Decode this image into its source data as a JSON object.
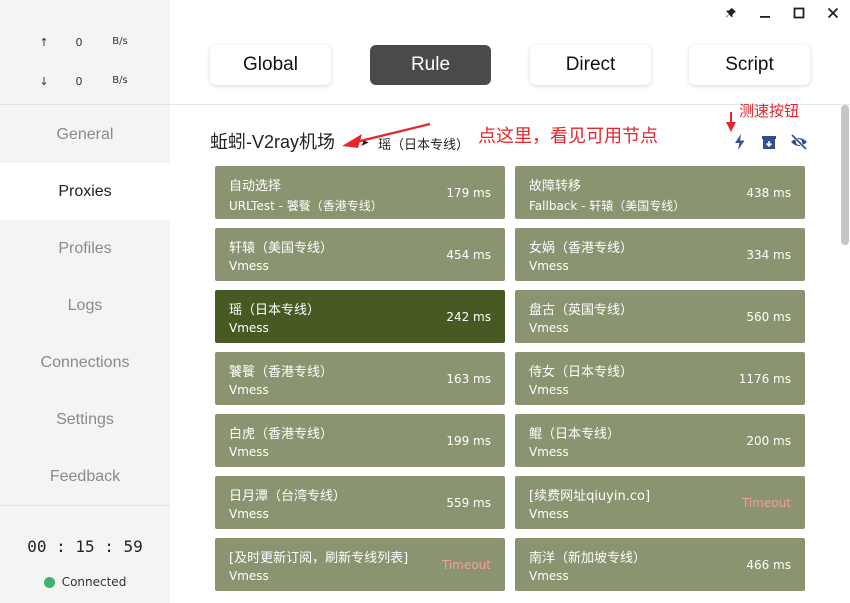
{
  "window": {
    "pin_icon": "pin-icon",
    "minimize_icon": "minimize-icon",
    "maximize_icon": "maximize-icon",
    "close_icon": "close-icon"
  },
  "traffic": {
    "up_arrow": "↑",
    "up_value": "0",
    "up_unit": "B/s",
    "down_arrow": "↓",
    "down_value": "0",
    "down_unit": "B/s"
  },
  "sidebar": {
    "items": [
      {
        "label": "General",
        "active": false
      },
      {
        "label": "Proxies",
        "active": true
      },
      {
        "label": "Profiles",
        "active": false
      },
      {
        "label": "Logs",
        "active": false
      },
      {
        "label": "Connections",
        "active": false
      },
      {
        "label": "Settings",
        "active": false
      },
      {
        "label": "Feedback",
        "active": false
      }
    ],
    "clock": "00 : 15 : 59",
    "status": "Connected",
    "status_color": "#3cb371"
  },
  "modes": [
    {
      "label": "Global",
      "active": false
    },
    {
      "label": "Rule",
      "active": true
    },
    {
      "label": "Direct",
      "active": false
    },
    {
      "label": "Script",
      "active": false
    }
  ],
  "group": {
    "title": "蚯蚓-V2ray机场",
    "arrow": "➤",
    "selected": "瑶（日本专线）",
    "speed_test_icon": "lightning-icon",
    "select_icon": "locate-box-icon",
    "hide_icon": "eye-slash-icon"
  },
  "annotations": {
    "main": "点这里，看见可用节点",
    "speed": "测速按钮"
  },
  "colors": {
    "card": "#8a9470",
    "card_selected": "#485a23",
    "timeout": "#f0a296",
    "annotation": "#e5262c"
  },
  "proxies": [
    {
      "name": "自动选择",
      "type": "URLTest - 饕餮（香港专线）",
      "delay": "179 ms",
      "selected": false,
      "timeout": false
    },
    {
      "name": "故障转移",
      "type": "Fallback - 轩辕（美国专线）",
      "delay": "438 ms",
      "selected": false,
      "timeout": false
    },
    {
      "name": "轩辕（美国专线）",
      "type": "Vmess",
      "delay": "454 ms",
      "selected": false,
      "timeout": false
    },
    {
      "name": "女娲（香港专线）",
      "type": "Vmess",
      "delay": "334 ms",
      "selected": false,
      "timeout": false
    },
    {
      "name": "瑶（日本专线）",
      "type": "Vmess",
      "delay": "242 ms",
      "selected": true,
      "timeout": false
    },
    {
      "name": "盘古（英国专线）",
      "type": "Vmess",
      "delay": "560 ms",
      "selected": false,
      "timeout": false
    },
    {
      "name": "饕餮（香港专线）",
      "type": "Vmess",
      "delay": "163 ms",
      "selected": false,
      "timeout": false
    },
    {
      "name": "侍女（日本专线）",
      "type": "Vmess",
      "delay": "1176 ms",
      "selected": false,
      "timeout": false
    },
    {
      "name": "白虎（香港专线）",
      "type": "Vmess",
      "delay": "199 ms",
      "selected": false,
      "timeout": false
    },
    {
      "name": "鲲（日本专线）",
      "type": "Vmess",
      "delay": "200 ms",
      "selected": false,
      "timeout": false
    },
    {
      "name": "日月潭（台湾专线）",
      "type": "Vmess",
      "delay": "559 ms",
      "selected": false,
      "timeout": false
    },
    {
      "name": "[续费网址qiuyin.co]",
      "type": "Vmess",
      "delay": "Timeout",
      "selected": false,
      "timeout": true
    },
    {
      "name": "[及时更新订阅，刷新专线列表]",
      "type": "Vmess",
      "delay": "Timeout",
      "selected": false,
      "timeout": true
    },
    {
      "name": "南洋（新加坡专线）",
      "type": "Vmess",
      "delay": "466 ms",
      "selected": false,
      "timeout": false
    }
  ]
}
